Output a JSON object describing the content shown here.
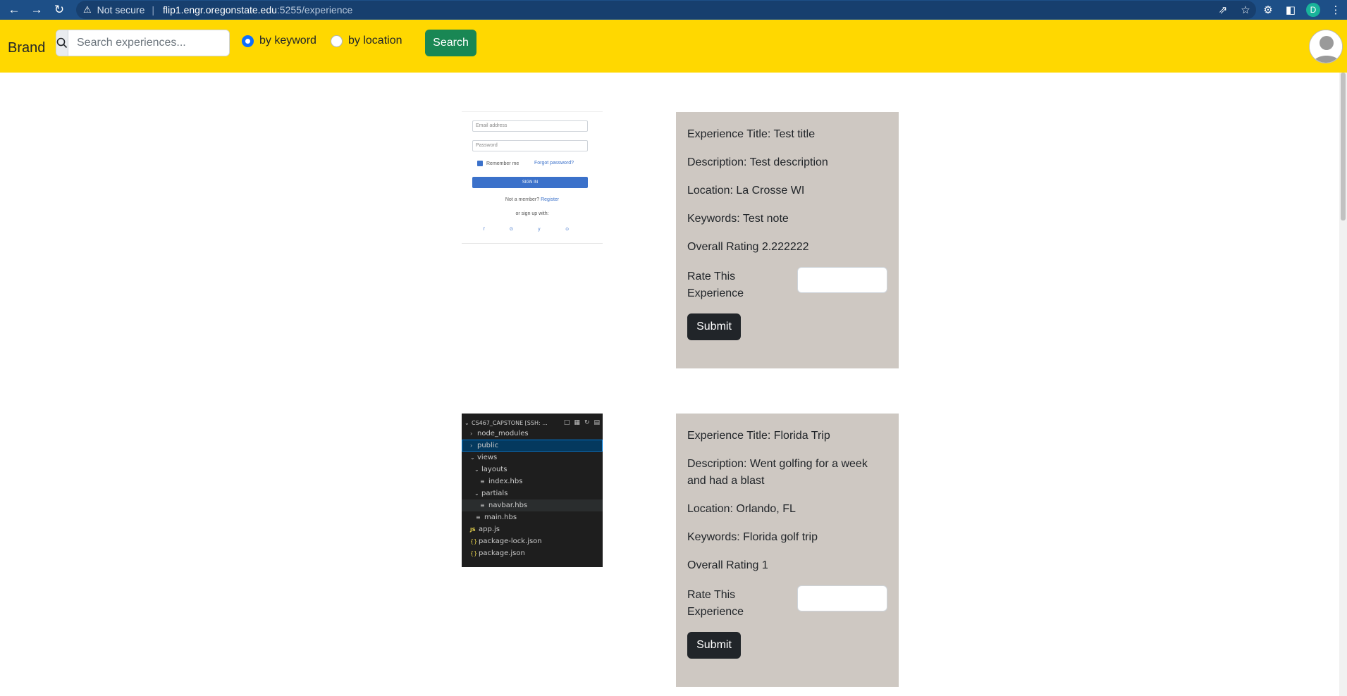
{
  "browser": {
    "security_label": "Not secure",
    "url_host": "flip1.engr.oregonstate.edu",
    "url_path": ":5255/experience",
    "profile_initial": "D"
  },
  "navbar": {
    "brand": "Brand",
    "search_placeholder": "Search experiences...",
    "radio_keyword": "by keyword",
    "radio_location": "by location",
    "search_button": "Search",
    "selected_mode": "by keyword"
  },
  "experiences": [
    {
      "title": "Experience Title: Test title",
      "description": "Description: Test description",
      "location": "Location: La Crosse WI",
      "keywords": "Keywords: Test note",
      "rating": "Overall Rating 2.222222",
      "rate_label": "Rate This Experience",
      "submit": "Submit",
      "image": {
        "email_placeholder": "Email address",
        "password_placeholder": "Password",
        "remember": "Remember me",
        "forgot": "Forgot password?",
        "sign_in": "SIGN IN",
        "not_member": "Not a member?",
        "register": "Register",
        "or_sign_up": "or sign up with:",
        "socials": "f G y ⊙"
      }
    },
    {
      "title": "Experience Title: Florida Trip",
      "description": "Description: Went golfing for a week and had a blast",
      "location": "Location: Orlando, FL",
      "keywords": "Keywords: Florida golf trip",
      "rating": "Overall Rating 1",
      "rate_label": "Rate This Experience",
      "submit": "Submit",
      "image": {
        "header": "CS467_CAPSTONE [SSH: ...",
        "tree": {
          "node_modules": "node_modules",
          "public": "public",
          "views": "views",
          "layouts": "layouts",
          "index": "index.hbs",
          "partials": "partials",
          "navbar": "navbar.hbs",
          "main": "main.hbs",
          "app": "app.js",
          "package_lock": "package-lock.json",
          "package": "package.json"
        }
      }
    }
  ],
  "colors": {
    "navbar": "#ffd800",
    "search_button": "#198754",
    "card": "#cec8c2",
    "submit": "#212529",
    "chrome": "#1d4f87"
  }
}
